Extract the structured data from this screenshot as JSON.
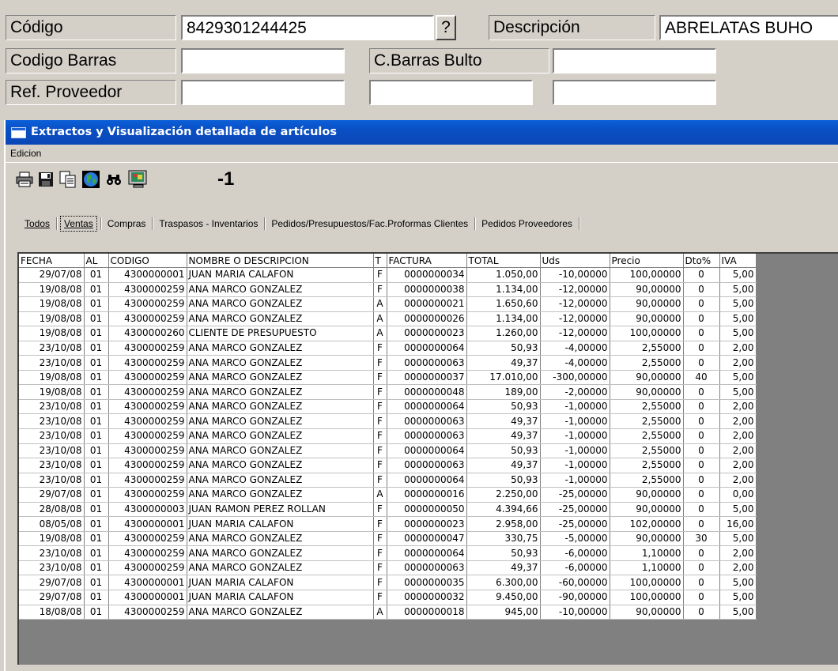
{
  "form": {
    "codigo_label": "Código",
    "codigo_value": "8429301244425",
    "lookup_button": "?",
    "descripcion_label": "Descripción",
    "descripcion_value": "ABRELATAS BUHO",
    "codigo_barras_label": "Codigo Barras",
    "codigo_barras_value": "",
    "cbarras_bulto_label": "C.Barras Bulto",
    "cbarras_bulto_value": "",
    "ref_proveedor_label": "Ref. Proveedor",
    "ref_proveedor_value": "",
    "ref_extra_1": "",
    "ref_extra_2": ""
  },
  "window": {
    "title": "Extractos y Visualización detallada de artículos",
    "menu": [
      "Edicion"
    ],
    "toolbar": {
      "icons": [
        "print-icon",
        "save-icon",
        "copy-icon",
        "globe-icon",
        "binoculars-icon",
        "monitor-icon"
      ],
      "counter": "-1"
    },
    "tabs": [
      {
        "label": "Todos",
        "active": false
      },
      {
        "label": "Ventas",
        "active": true
      },
      {
        "label": "Compras",
        "active": false
      },
      {
        "label": "Traspasos - Inventarios",
        "active": false
      },
      {
        "label": "Pedidos/Presupuestos/Fac.Proformas Clientes",
        "active": false
      },
      {
        "label": "Pedidos Proveedores",
        "active": false
      }
    ]
  },
  "table": {
    "columns": [
      "FECHA",
      "AL",
      "CODIGO",
      "NOMBRE O DESCRIPCION",
      "T",
      "FACTURA",
      "TOTAL",
      "Uds",
      "Precio",
      "Dto%",
      "IVA"
    ],
    "rows": [
      [
        "29/07/08",
        "01",
        "4300000001",
        "JUAN MARIA CALAFON",
        "F",
        "0000000034",
        "1.050,00",
        "-10,00000",
        "100,00000",
        "0",
        "5,00"
      ],
      [
        "19/08/08",
        "01",
        "4300000259",
        "ANA MARCO GONZALEZ",
        "F",
        "0000000038",
        "1.134,00",
        "-12,00000",
        "90,00000",
        "0",
        "5,00"
      ],
      [
        "19/08/08",
        "01",
        "4300000259",
        "ANA MARCO GONZALEZ",
        "A",
        "0000000021",
        "1.650,60",
        "-12,00000",
        "90,00000",
        "0",
        "5,00"
      ],
      [
        "19/08/08",
        "01",
        "4300000259",
        "ANA MARCO GONZALEZ",
        "A",
        "0000000026",
        "1.134,00",
        "-12,00000",
        "90,00000",
        "0",
        "5,00"
      ],
      [
        "19/08/08",
        "01",
        "4300000260",
        "CLIENTE DE PRESUPUESTO",
        "A",
        "0000000023",
        "1.260,00",
        "-12,00000",
        "100,00000",
        "0",
        "5,00"
      ],
      [
        "23/10/08",
        "01",
        "4300000259",
        "ANA MARCO GONZALEZ",
        "F",
        "0000000064",
        "50,93",
        "-4,00000",
        "2,55000",
        "0",
        "2,00"
      ],
      [
        "23/10/08",
        "01",
        "4300000259",
        "ANA MARCO GONZALEZ",
        "F",
        "0000000063",
        "49,37",
        "-4,00000",
        "2,55000",
        "0",
        "2,00"
      ],
      [
        "19/08/08",
        "01",
        "4300000259",
        "ANA MARCO GONZALEZ",
        "F",
        "0000000037",
        "17.010,00",
        "-300,00000",
        "90,00000",
        "40",
        "5,00"
      ],
      [
        "19/08/08",
        "01",
        "4300000259",
        "ANA MARCO GONZALEZ",
        "F",
        "0000000048",
        "189,00",
        "-2,00000",
        "90,00000",
        "0",
        "5,00"
      ],
      [
        "23/10/08",
        "01",
        "4300000259",
        "ANA MARCO GONZALEZ",
        "F",
        "0000000064",
        "50,93",
        "-1,00000",
        "2,55000",
        "0",
        "2,00"
      ],
      [
        "23/10/08",
        "01",
        "4300000259",
        "ANA MARCO GONZALEZ",
        "F",
        "0000000063",
        "49,37",
        "-1,00000",
        "2,55000",
        "0",
        "2,00"
      ],
      [
        "23/10/08",
        "01",
        "4300000259",
        "ANA MARCO GONZALEZ",
        "F",
        "0000000063",
        "49,37",
        "-1,00000",
        "2,55000",
        "0",
        "2,00"
      ],
      [
        "23/10/08",
        "01",
        "4300000259",
        "ANA MARCO GONZALEZ",
        "F",
        "0000000064",
        "50,93",
        "-1,00000",
        "2,55000",
        "0",
        "2,00"
      ],
      [
        "23/10/08",
        "01",
        "4300000259",
        "ANA MARCO GONZALEZ",
        "F",
        "0000000063",
        "49,37",
        "-1,00000",
        "2,55000",
        "0",
        "2,00"
      ],
      [
        "23/10/08",
        "01",
        "4300000259",
        "ANA MARCO GONZALEZ",
        "F",
        "0000000064",
        "50,93",
        "-1,00000",
        "2,55000",
        "0",
        "2,00"
      ],
      [
        "29/07/08",
        "01",
        "4300000259",
        "ANA MARCO GONZALEZ",
        "A",
        "0000000016",
        "2.250,00",
        "-25,00000",
        "90,00000",
        "0",
        "0,00"
      ],
      [
        "28/08/08",
        "01",
        "4300000003",
        "JUAN RAMON PEREZ ROLLAN",
        "F",
        "0000000050",
        "4.394,66",
        "-25,00000",
        "90,00000",
        "0",
        "5,00"
      ],
      [
        "08/05/08",
        "01",
        "4300000001",
        "JUAN MARIA CALAFON",
        "F",
        "0000000023",
        "2.958,00",
        "-25,00000",
        "102,00000",
        "0",
        "16,00"
      ],
      [
        "19/08/08",
        "01",
        "4300000259",
        "ANA MARCO GONZALEZ",
        "F",
        "0000000047",
        "330,75",
        "-5,00000",
        "90,00000",
        "30",
        "5,00"
      ],
      [
        "23/10/08",
        "01",
        "4300000259",
        "ANA MARCO GONZALEZ",
        "F",
        "0000000064",
        "50,93",
        "-6,00000",
        "1,10000",
        "0",
        "2,00"
      ],
      [
        "23/10/08",
        "01",
        "4300000259",
        "ANA MARCO GONZALEZ",
        "F",
        "0000000063",
        "49,37",
        "-6,00000",
        "1,10000",
        "0",
        "2,00"
      ],
      [
        "29/07/08",
        "01",
        "4300000001",
        "JUAN MARIA CALAFON",
        "F",
        "0000000035",
        "6.300,00",
        "-60,00000",
        "100,00000",
        "0",
        "5,00"
      ],
      [
        "29/07/08",
        "01",
        "4300000001",
        "JUAN MARIA CALAFON",
        "F",
        "0000000032",
        "9.450,00",
        "-90,00000",
        "100,00000",
        "0",
        "5,00"
      ],
      [
        "18/08/08",
        "01",
        "4300000259",
        "ANA MARCO GONZALEZ",
        "A",
        "0000000018",
        "945,00",
        "-10,00000",
        "90,00000",
        "0",
        "5,00"
      ]
    ]
  }
}
